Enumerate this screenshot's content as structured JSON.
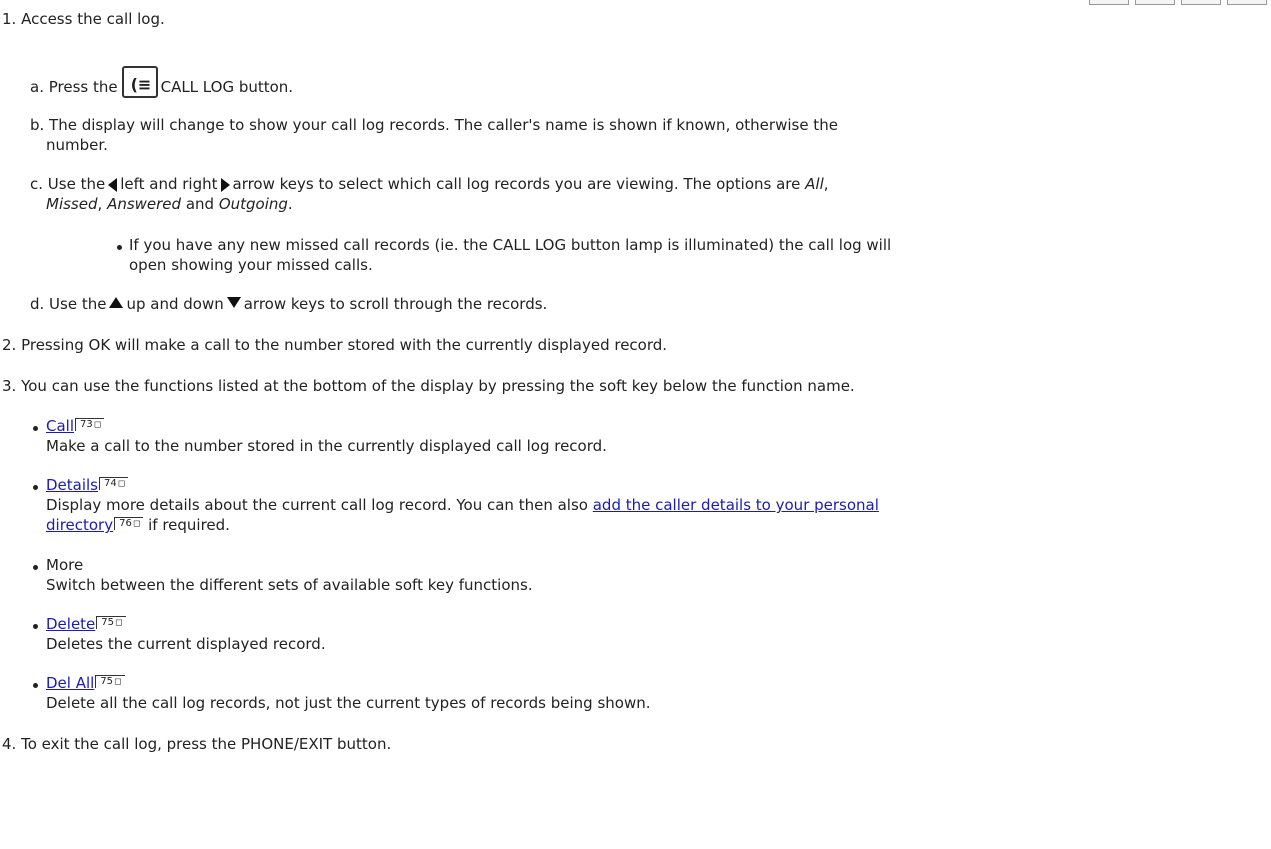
{
  "steps": {
    "s1": "1. Access the call log.",
    "a_prefix": "a. Press the",
    "a_suffix": "CALL LOG button.",
    "b1": "b. The display will change to show your call log records. The caller's name is shown if known, otherwise the",
    "b2": "number.",
    "c_prefix": "c. Use the",
    "c_mid": "left and right",
    "c_tail": "arrow keys to select which call log records you are viewing. The options are",
    "c_opt_all": "All",
    "c_comma": ",",
    "c_opt_missed": "Missed",
    "c_sep": ",",
    "c_opt_answered": "Answered",
    "c_and": " and ",
    "c_opt_outgoing": "Outgoing",
    "c_end": ".",
    "c_bullet1": "If you have any new missed call records (ie. the CALL LOG button lamp is illuminated) the call log will",
    "c_bullet2": "open showing your missed calls.",
    "d_prefix": "d. Use the",
    "d_mid": "up and down",
    "d_tail": "arrow keys to scroll through the records.",
    "s2": "2. Pressing OK will make a call to the number stored with the currently displayed record.",
    "s3": "3. You can use the functions listed at the bottom of the display by pressing the soft key below the function name.",
    "s4": "4. To exit the call log, press the PHONE/EXIT button."
  },
  "functions": {
    "call": {
      "label": "Call",
      "page": "73",
      "desc": "Make a call to the number stored in the currently displayed call log record."
    },
    "details": {
      "label": "Details",
      "page": "74",
      "desc_prefix": "Display more details about the current call log record. You can then also",
      "link1": "add the caller details to your personal",
      "link2": "directory",
      "link_page": "76",
      "desc_suffix": "if required."
    },
    "more": {
      "label": "More",
      "desc": "Switch between the different sets of available soft key functions."
    },
    "delete": {
      "label": "Delete",
      "page": "75",
      "desc": "Deletes the current displayed record."
    },
    "delall": {
      "label": "Del All",
      "page": "75",
      "desc": "Delete all the call log records, not just the current types of records being shown."
    }
  },
  "icons": {
    "call_log_button": "call-log-icon",
    "arrow_left": "arrow-left-icon",
    "arrow_right": "arrow-right-icon",
    "arrow_up": "arrow-up-icon",
    "arrow_down": "arrow-down-icon",
    "page_ref": "page-reference-icon"
  },
  "colors": {
    "link": "#1a1ab8",
    "text": "#222222"
  }
}
